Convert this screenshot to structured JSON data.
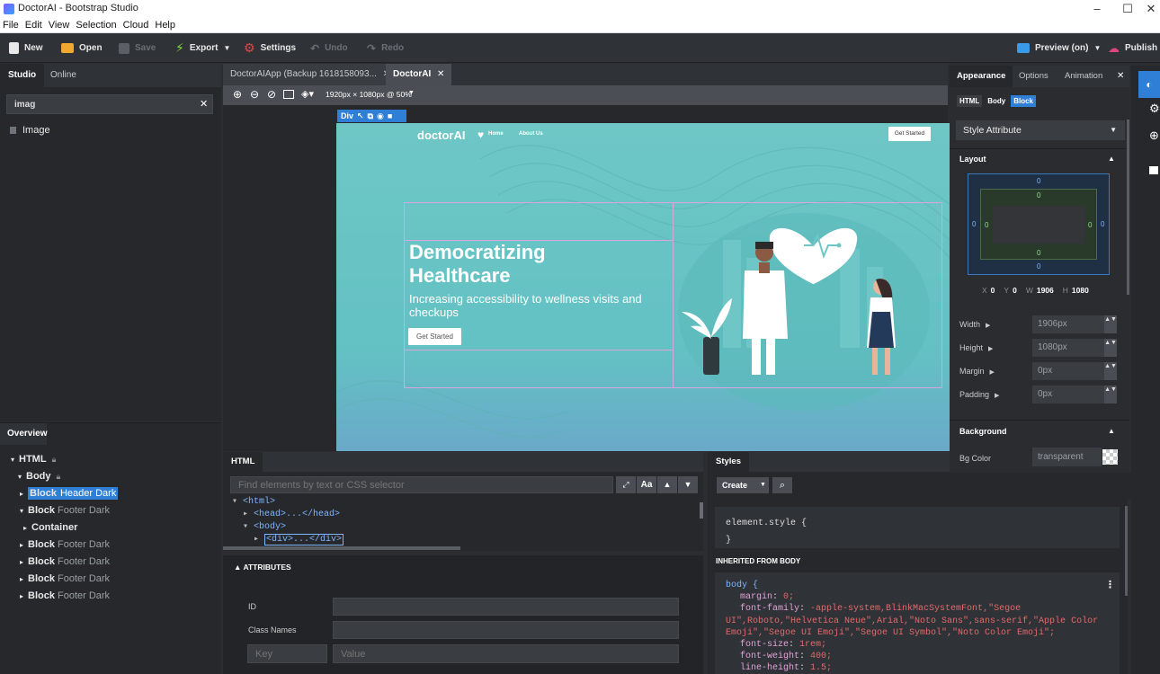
{
  "window": {
    "title": "DoctorAI - Bootstrap Studio",
    "min": "–",
    "max": "☐",
    "close": "✕"
  },
  "menu": [
    "File",
    "Edit",
    "View",
    "Selection",
    "Cloud",
    "Help"
  ],
  "toolbar": {
    "new": "New",
    "open": "Open",
    "save": "Save",
    "export": "Export",
    "settings": "Settings",
    "undo": "Undo",
    "redo": "Redo",
    "preview": "Preview (on)",
    "publish": "Publish"
  },
  "left": {
    "tabs": [
      "Studio",
      "Online"
    ],
    "search_value": "imag",
    "results": [
      "Image"
    ],
    "overview_title": "Overview",
    "tree": [
      {
        "label": "HTML",
        "suffix": "",
        "lock": true,
        "level": 0,
        "arrow": "▾"
      },
      {
        "label": "Body",
        "suffix": "",
        "lock": true,
        "level": 1,
        "arrow": "▾"
      },
      {
        "label": "Block",
        "suffix": "Header Dark",
        "level": 2,
        "arrow": "▸",
        "selected": true
      },
      {
        "label": "Block",
        "suffix": "Footer Dark",
        "level": 2,
        "arrow": "▾"
      },
      {
        "label": "Container",
        "suffix": "",
        "level": 3,
        "arrow": "▸"
      },
      {
        "label": "Block",
        "suffix": "Footer Dark",
        "level": 2,
        "arrow": "▸"
      },
      {
        "label": "Block",
        "suffix": "Footer Dark",
        "level": 2,
        "arrow": "▸"
      },
      {
        "label": "Block",
        "suffix": "Footer Dark",
        "level": 2,
        "arrow": "▸"
      },
      {
        "label": "Block",
        "suffix": "Footer Dark",
        "level": 2,
        "arrow": "▸"
      }
    ]
  },
  "center": {
    "tabs": [
      "DoctorAIApp (Backup 1618158093...",
      "DoctorAI"
    ],
    "viewport": "1920px × 1080px @ 50%",
    "div_badge": "Div",
    "site": {
      "brand": "doctorAI",
      "nav": [
        "Home",
        "About Us"
      ],
      "cta_top": "Get Started",
      "heading": "Democratizing Healthcare",
      "sub": "Increasing accessibility to wellness visits and checkups",
      "cta": "Get Started"
    }
  },
  "html_panel": {
    "tab": "HTML",
    "find_placeholder": "Find elements by text or CSS selector",
    "aa": "Aa",
    "lines": [
      "<html>",
      "<head>...</head>",
      "<body>",
      "<div>...</div>"
    ],
    "attributes_title": "ATTRIBUTES",
    "id_label": "ID",
    "class_label": "Class Names",
    "key_placeholder": "Key",
    "value_placeholder": "Value"
  },
  "styles_panel": {
    "tab": "Styles",
    "create": "Create",
    "element_style": "element.style {",
    "close_brace": "}",
    "inherited": "INHERITED FROM BODY",
    "body_selector": "body {",
    "rules": [
      {
        "prop": "margin",
        "val": "0;"
      },
      {
        "prop": "font-family",
        "val": "-apple-system,BlinkMacSystemFont,\"Segoe UI\",Roboto,\"Helvetica Neue\",Arial,\"Noto Sans\",sans-serif,\"Apple Color Emoji\",\"Segoe UI Emoji\",\"Segoe UI Symbol\",\"Noto Color Emoji\";"
      },
      {
        "prop": "font-size",
        "val": "1rem;"
      },
      {
        "prop": "font-weight",
        "val": "400;"
      },
      {
        "prop": "line-height",
        "val": "1.5;"
      }
    ]
  },
  "right": {
    "tabs": [
      "Appearance",
      "Options",
      "Animation"
    ],
    "subtabs": [
      "HTML",
      "Body",
      "Block"
    ],
    "style_attr": "Style Attribute",
    "layout_title": "Layout",
    "box": {
      "m_top": "0",
      "m_bottom": "0",
      "m_left": "0",
      "m_right": "0",
      "p_top": "0",
      "p_bottom": "0",
      "p_left": "0",
      "p_right": "0"
    },
    "coords": {
      "x_label": "X",
      "x": "0",
      "y_label": "Y",
      "y": "0",
      "w_label": "W",
      "w": "1906",
      "h_label": "H",
      "h": "1080"
    },
    "props": [
      {
        "label": "Width",
        "value": "1906px"
      },
      {
        "label": "Height",
        "value": "1080px"
      },
      {
        "label": "Margin",
        "value": "0px"
      },
      {
        "label": "Padding",
        "value": "0px"
      }
    ],
    "background_title": "Background",
    "bg_label": "Bg Color",
    "bg_value": "transparent"
  },
  "colors": {
    "accent": "#2f7fd6",
    "publish": "#e0457b",
    "teal": "#6ec7c5",
    "code_prop": "#e3a2d9",
    "code_val": "#e26a6a"
  }
}
